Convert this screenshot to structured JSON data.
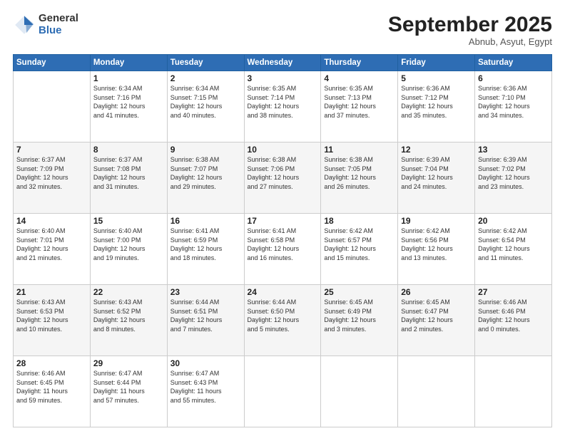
{
  "logo": {
    "general": "General",
    "blue": "Blue"
  },
  "header": {
    "month": "September 2025",
    "location": "Abnub, Asyut, Egypt"
  },
  "weekdays": [
    "Sunday",
    "Monday",
    "Tuesday",
    "Wednesday",
    "Thursday",
    "Friday",
    "Saturday"
  ],
  "weeks": [
    [
      {
        "day": "",
        "info": ""
      },
      {
        "day": "1",
        "info": "Sunrise: 6:34 AM\nSunset: 7:16 PM\nDaylight: 12 hours\nand 41 minutes."
      },
      {
        "day": "2",
        "info": "Sunrise: 6:34 AM\nSunset: 7:15 PM\nDaylight: 12 hours\nand 40 minutes."
      },
      {
        "day": "3",
        "info": "Sunrise: 6:35 AM\nSunset: 7:14 PM\nDaylight: 12 hours\nand 38 minutes."
      },
      {
        "day": "4",
        "info": "Sunrise: 6:35 AM\nSunset: 7:13 PM\nDaylight: 12 hours\nand 37 minutes."
      },
      {
        "day": "5",
        "info": "Sunrise: 6:36 AM\nSunset: 7:12 PM\nDaylight: 12 hours\nand 35 minutes."
      },
      {
        "day": "6",
        "info": "Sunrise: 6:36 AM\nSunset: 7:10 PM\nDaylight: 12 hours\nand 34 minutes."
      }
    ],
    [
      {
        "day": "7",
        "info": "Sunrise: 6:37 AM\nSunset: 7:09 PM\nDaylight: 12 hours\nand 32 minutes."
      },
      {
        "day": "8",
        "info": "Sunrise: 6:37 AM\nSunset: 7:08 PM\nDaylight: 12 hours\nand 31 minutes."
      },
      {
        "day": "9",
        "info": "Sunrise: 6:38 AM\nSunset: 7:07 PM\nDaylight: 12 hours\nand 29 minutes."
      },
      {
        "day": "10",
        "info": "Sunrise: 6:38 AM\nSunset: 7:06 PM\nDaylight: 12 hours\nand 27 minutes."
      },
      {
        "day": "11",
        "info": "Sunrise: 6:38 AM\nSunset: 7:05 PM\nDaylight: 12 hours\nand 26 minutes."
      },
      {
        "day": "12",
        "info": "Sunrise: 6:39 AM\nSunset: 7:04 PM\nDaylight: 12 hours\nand 24 minutes."
      },
      {
        "day": "13",
        "info": "Sunrise: 6:39 AM\nSunset: 7:02 PM\nDaylight: 12 hours\nand 23 minutes."
      }
    ],
    [
      {
        "day": "14",
        "info": "Sunrise: 6:40 AM\nSunset: 7:01 PM\nDaylight: 12 hours\nand 21 minutes."
      },
      {
        "day": "15",
        "info": "Sunrise: 6:40 AM\nSunset: 7:00 PM\nDaylight: 12 hours\nand 19 minutes."
      },
      {
        "day": "16",
        "info": "Sunrise: 6:41 AM\nSunset: 6:59 PM\nDaylight: 12 hours\nand 18 minutes."
      },
      {
        "day": "17",
        "info": "Sunrise: 6:41 AM\nSunset: 6:58 PM\nDaylight: 12 hours\nand 16 minutes."
      },
      {
        "day": "18",
        "info": "Sunrise: 6:42 AM\nSunset: 6:57 PM\nDaylight: 12 hours\nand 15 minutes."
      },
      {
        "day": "19",
        "info": "Sunrise: 6:42 AM\nSunset: 6:56 PM\nDaylight: 12 hours\nand 13 minutes."
      },
      {
        "day": "20",
        "info": "Sunrise: 6:42 AM\nSunset: 6:54 PM\nDaylight: 12 hours\nand 11 minutes."
      }
    ],
    [
      {
        "day": "21",
        "info": "Sunrise: 6:43 AM\nSunset: 6:53 PM\nDaylight: 12 hours\nand 10 minutes."
      },
      {
        "day": "22",
        "info": "Sunrise: 6:43 AM\nSunset: 6:52 PM\nDaylight: 12 hours\nand 8 minutes."
      },
      {
        "day": "23",
        "info": "Sunrise: 6:44 AM\nSunset: 6:51 PM\nDaylight: 12 hours\nand 7 minutes."
      },
      {
        "day": "24",
        "info": "Sunrise: 6:44 AM\nSunset: 6:50 PM\nDaylight: 12 hours\nand 5 minutes."
      },
      {
        "day": "25",
        "info": "Sunrise: 6:45 AM\nSunset: 6:49 PM\nDaylight: 12 hours\nand 3 minutes."
      },
      {
        "day": "26",
        "info": "Sunrise: 6:45 AM\nSunset: 6:47 PM\nDaylight: 12 hours\nand 2 minutes."
      },
      {
        "day": "27",
        "info": "Sunrise: 6:46 AM\nSunset: 6:46 PM\nDaylight: 12 hours\nand 0 minutes."
      }
    ],
    [
      {
        "day": "28",
        "info": "Sunrise: 6:46 AM\nSunset: 6:45 PM\nDaylight: 11 hours\nand 59 minutes."
      },
      {
        "day": "29",
        "info": "Sunrise: 6:47 AM\nSunset: 6:44 PM\nDaylight: 11 hours\nand 57 minutes."
      },
      {
        "day": "30",
        "info": "Sunrise: 6:47 AM\nSunset: 6:43 PM\nDaylight: 11 hours\nand 55 minutes."
      },
      {
        "day": "",
        "info": ""
      },
      {
        "day": "",
        "info": ""
      },
      {
        "day": "",
        "info": ""
      },
      {
        "day": "",
        "info": ""
      }
    ]
  ]
}
